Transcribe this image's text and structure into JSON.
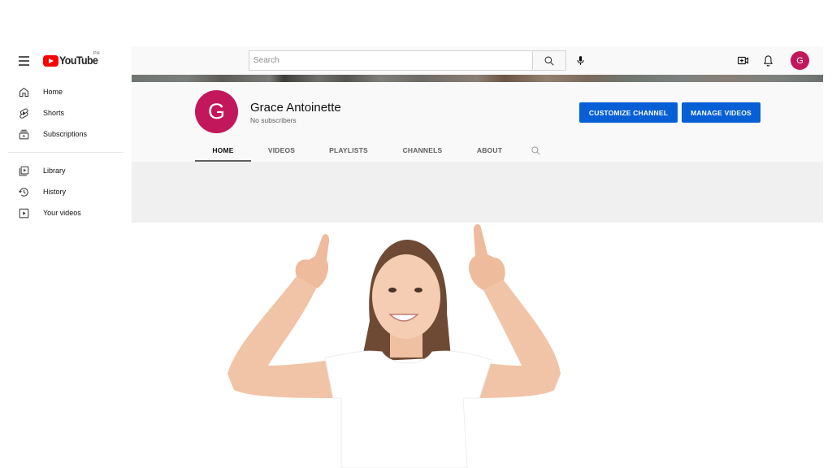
{
  "app": {
    "logo_text": "YouTube",
    "logo_country": "PH"
  },
  "icons": {
    "menu": "hamburger-menu-icon",
    "search": "search-icon",
    "mic": "microphone-icon",
    "create": "create-video-icon",
    "notifications": "bell-icon"
  },
  "search": {
    "placeholder": "Search",
    "value": ""
  },
  "user": {
    "avatar_initial": "G",
    "avatar_color": "#c2185b"
  },
  "sidebar": {
    "items": [
      {
        "label": "Home",
        "icon": "home-icon"
      },
      {
        "label": "Shorts",
        "icon": "shorts-icon"
      },
      {
        "label": "Subscriptions",
        "icon": "subscriptions-icon"
      }
    ],
    "items2": [
      {
        "label": "Library",
        "icon": "library-icon"
      },
      {
        "label": "History",
        "icon": "history-icon"
      },
      {
        "label": "Your videos",
        "icon": "your-videos-icon"
      }
    ]
  },
  "channel": {
    "name": "Grace Antoinette",
    "subscribers": "No subscribers",
    "avatar_initial": "G",
    "customize_label": "CUSTOMIZE CHANNEL",
    "manage_label": "MANAGE VIDEOS",
    "accent": "#065fd4"
  },
  "tabs": [
    {
      "label": "HOME",
      "active": true
    },
    {
      "label": "VIDEOS",
      "active": false
    },
    {
      "label": "PLAYLISTS",
      "active": false
    },
    {
      "label": "CHANNELS",
      "active": false
    },
    {
      "label": "ABOUT",
      "active": false
    }
  ],
  "overlay_image": {
    "description": "Smiling young woman in white t-shirt pointing up with both index fingers"
  }
}
